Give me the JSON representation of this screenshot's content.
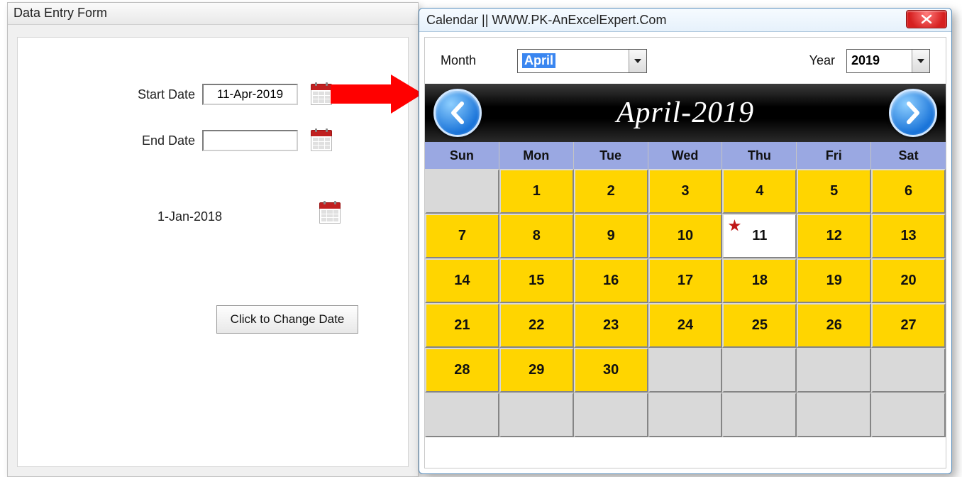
{
  "form": {
    "title": "Data Entry Form",
    "start_label": "Start Date",
    "start_value": "11-Apr-2019",
    "end_label": "End Date",
    "end_value": "",
    "static_date": "1-Jan-2018",
    "change_button": "Click to Change Date"
  },
  "calendar": {
    "title": "Calendar || WWW.PK-AnExcelExpert.Com",
    "month_label": "Month",
    "month_value": "April",
    "year_label": "Year",
    "year_value": "2019",
    "banner": "April-2019",
    "dow": [
      "Sun",
      "Mon",
      "Tue",
      "Wed",
      "Thu",
      "Fri",
      "Sat"
    ],
    "weeks": [
      [
        "",
        "1",
        "2",
        "3",
        "4",
        "5",
        "6"
      ],
      [
        "7",
        "8",
        "9",
        "10",
        "11",
        "12",
        "13"
      ],
      [
        "14",
        "15",
        "16",
        "17",
        "18",
        "19",
        "20"
      ],
      [
        "21",
        "22",
        "23",
        "24",
        "25",
        "26",
        "27"
      ],
      [
        "28",
        "29",
        "30",
        "",
        "",
        "",
        ""
      ],
      [
        "",
        "",
        "",
        "",
        "",
        "",
        ""
      ]
    ],
    "today": "11"
  }
}
